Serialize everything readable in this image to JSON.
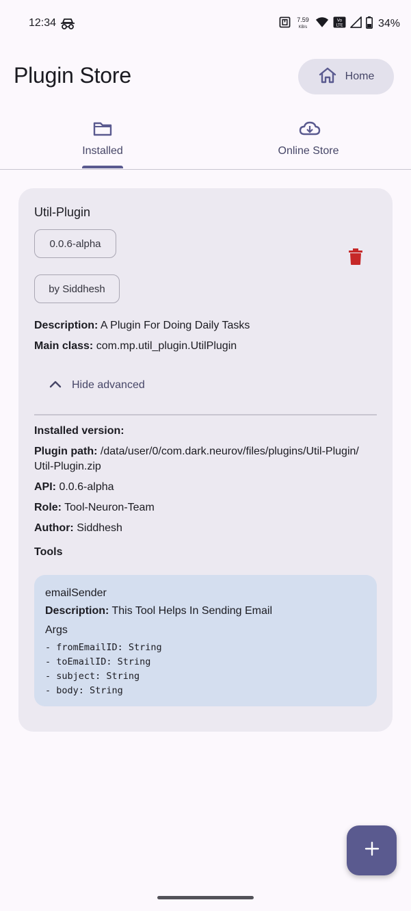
{
  "status_bar": {
    "time": "12:34",
    "left_icon": "incognito-icon",
    "net_speed_value": "7.59",
    "net_speed_unit": "KB/s",
    "volte_label": "Vo LTE",
    "battery_percent": "34%",
    "icons": [
      "nfc-icon",
      "wifi-icon",
      "volte-icon",
      "signal-icon",
      "battery-icon"
    ]
  },
  "header": {
    "title": "Plugin Store",
    "home_button": {
      "label": "Home",
      "icon": "home-icon"
    }
  },
  "tabs": [
    {
      "label": "Installed",
      "icon": "folder-icon",
      "selected": true
    },
    {
      "label": "Online Store",
      "icon": "cloud-download-icon",
      "selected": false
    }
  ],
  "plugin": {
    "name": "Util-Plugin",
    "version_chip": "0.0.6-alpha",
    "author_chip": "by Siddhesh",
    "description_label": "Description:",
    "description_value": "A Plugin For Doing Daily Tasks",
    "main_class_label": "Main class:",
    "main_class_value": "com.mp.util_plugin.UtilPlugin",
    "advanced_toggle": "Hide advanced",
    "installed_version_label": "Installed version:",
    "plugin_path_label": "Plugin path:",
    "plugin_path_value_line1": "/data/user/0/com.dark.neurov/files/plugins/Util-Plugin/",
    "plugin_path_value_line2": "Util-Plugin.zip",
    "api_label": "API:",
    "api_value": "0.0.6-alpha",
    "role_label": "Role:",
    "role_value": "Tool-Neuron-Team",
    "author_label": "Author:",
    "author_value": "Siddhesh",
    "tools_title": "Tools",
    "tools": [
      {
        "name": "emailSender",
        "description_label": "Description:",
        "description_value": "This Tool Helps In Sending Email",
        "args_title": "Args",
        "args": [
          "- fromEmailID: String",
          "- toEmailID: String",
          "- subject: String",
          "- body: String"
        ]
      }
    ]
  },
  "fab": {
    "icon": "plus-icon"
  },
  "colors": {
    "background": "#fcf8fd",
    "card": "#ece9f1",
    "tool_card": "#d4deef",
    "accent": "#5a5a8f",
    "delete": "#c62828"
  }
}
